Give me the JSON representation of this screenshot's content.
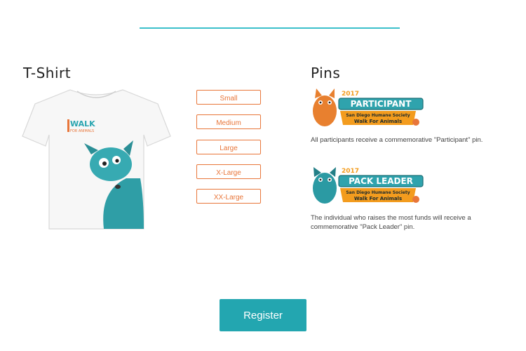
{
  "tshirt_section": {
    "title": "T-Shirt",
    "sizes": [
      "Small",
      "Medium",
      "Large",
      "X-Large",
      "XX-Large"
    ],
    "shirt_logo": {
      "line1": "WALK",
      "line2": "FOR ANIMALS"
    }
  },
  "pins_section": {
    "title": "Pins",
    "pins": [
      {
        "year": "2017",
        "name": "PARTICIPANT",
        "org": "San Diego Humane Society",
        "event": "Walk For Animals",
        "description": "All participants receive a commemorative \"Participant\" pin."
      },
      {
        "year": "2017",
        "name": "PACK LEADER",
        "org": "San Diego Humane Society",
        "event": "Walk For Animals",
        "description": "The individual who raises the most funds will receive a commemorative \"Pack Leader\" pin."
      }
    ]
  },
  "register_button": {
    "label": "Register"
  },
  "colors": {
    "accent": "#3cc0cb",
    "orange": "#e8763a",
    "button": "#23a6b0"
  }
}
